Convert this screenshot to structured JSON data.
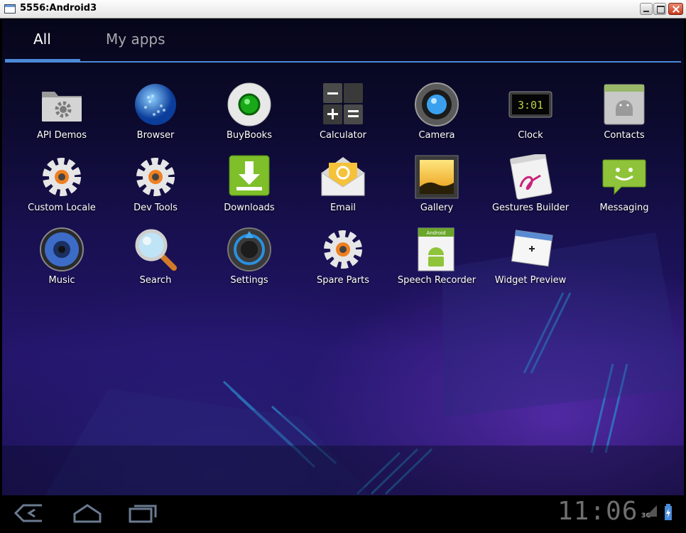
{
  "window": {
    "title": "5556:Android3"
  },
  "tabs": [
    {
      "label": "All",
      "selected": true
    },
    {
      "label": "My apps",
      "selected": false
    }
  ],
  "apps": [
    {
      "label": "API Demos",
      "icon": "folder-gear-icon"
    },
    {
      "label": "Browser",
      "icon": "globe-icon"
    },
    {
      "label": "BuyBooks",
      "icon": "green-button-icon"
    },
    {
      "label": "Calculator",
      "icon": "calculator-icon"
    },
    {
      "label": "Camera",
      "icon": "camera-lens-icon"
    },
    {
      "label": "Clock",
      "icon": "digital-clock-icon"
    },
    {
      "label": "Contacts",
      "icon": "contacts-card-icon"
    },
    {
      "label": "Custom Locale",
      "icon": "gear-icon"
    },
    {
      "label": "Dev Tools",
      "icon": "gear-icon"
    },
    {
      "label": "Downloads",
      "icon": "download-icon"
    },
    {
      "label": "Email",
      "icon": "envelope-icon"
    },
    {
      "label": "Gallery",
      "icon": "picture-frame-icon"
    },
    {
      "label": "Gestures Builder",
      "icon": "gesture-pad-icon"
    },
    {
      "label": "Messaging",
      "icon": "chat-bubble-icon"
    },
    {
      "label": "Music",
      "icon": "speaker-icon"
    },
    {
      "label": "Search",
      "icon": "magnifier-icon"
    },
    {
      "label": "Settings",
      "icon": "settings-knob-icon"
    },
    {
      "label": "Spare Parts",
      "icon": "gear-icon"
    },
    {
      "label": "Speech Recorder",
      "icon": "android-robot-icon"
    },
    {
      "label": "Widget Preview",
      "icon": "widget-card-icon"
    }
  ],
  "icon_clock_text": "3:01",
  "icon_speech_badge": "Android",
  "statusbar": {
    "time": "11:06",
    "network": "3G"
  },
  "colors": {
    "accent": "#4d8ad8",
    "clock": "#6f6f6f"
  }
}
